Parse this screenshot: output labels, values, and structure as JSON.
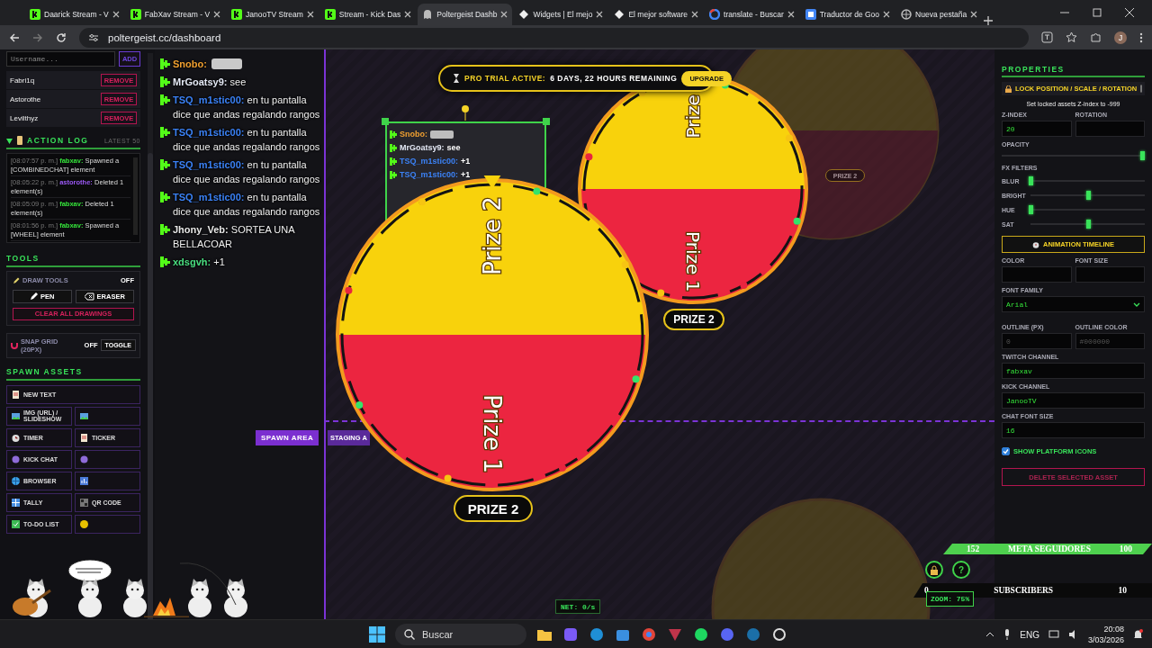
{
  "browser": {
    "tabs": [
      {
        "title": "Daarick Stream - V",
        "selected": false
      },
      {
        "title": "FabXav Stream - V",
        "selected": false
      },
      {
        "title": "JanooTV Stream",
        "selected": false
      },
      {
        "title": "Stream - Kick Das",
        "selected": false
      },
      {
        "title": "Poltergeist Dashb",
        "selected": true
      },
      {
        "title": "Widgets | El mejo",
        "selected": false
      },
      {
        "title": "El mejor software",
        "selected": false
      },
      {
        "title": "translate - Buscar",
        "selected": false
      },
      {
        "title": "Traductor de Goo",
        "selected": false
      },
      {
        "title": "Nueva pestaña",
        "selected": false
      }
    ],
    "url": "poltergeist.cc/dashboard",
    "profile": "J"
  },
  "sidebar": {
    "username": {
      "placeholder": "Username..."
    },
    "add_button": "ADD",
    "users": [
      {
        "name": "Fabri1q",
        "action": "REMOVE"
      },
      {
        "name": "Astorothe",
        "action": "REMOVE"
      },
      {
        "name": "Levilthyz",
        "action": "REMOVE"
      }
    ],
    "action_log": {
      "title": "ACTION LOG",
      "expanded": true,
      "badge": "LATEST 50",
      "entries": [
        {
          "time": "[08:07:57 p. m.]",
          "user": "fabxav:",
          "color": "#35e33a",
          "text": "Spawned a [COMBINEDCHAT] element"
        },
        {
          "time": "[08:05:22 p. m.]",
          "user": "astorothe:",
          "color": "#9b59f5",
          "text": "Deleted 1 element(s)"
        },
        {
          "time": "[08:05:09 p. m.]",
          "user": "fabxav:",
          "color": "#35e33a",
          "text": "Deleted 1 element(s)"
        },
        {
          "time": "[08:01:56 p. m.]",
          "user": "fabxav:",
          "color": "#35e33a",
          "text": "Spawned a [WHEEL] element"
        }
      ]
    },
    "tools": {
      "title": "TOOLS",
      "draw_tools": {
        "label": "DRAW TOOLS",
        "state": "OFF"
      },
      "buttons": [
        {
          "label": "PEN"
        },
        {
          "label": "ERASER"
        }
      ],
      "clear_button": "CLEAR ALL DRAWINGS",
      "snap_grid": {
        "label": "SNAP GRID (20PX)",
        "state": "OFF",
        "toggle": "TOGGLE"
      }
    },
    "spawn_assets": {
      "title": "SPAWN ASSETS",
      "items": [
        {
          "label": "NEW TEXT",
          "kind": "wide"
        },
        {
          "label": "IMG (URL) / SLIDESHOW",
          "kind": "half"
        },
        {
          "kind": "half"
        },
        {
          "label": "TIMER",
          "kind": "half"
        },
        {
          "label": "TICKER",
          "kind": "half"
        },
        {
          "label": "KICK CHAT",
          "kind": "half"
        },
        {
          "kind": "half"
        },
        {
          "label": "BROWSER",
          "kind": "half"
        },
        {
          "kind": "half"
        },
        {
          "label": "TALLY",
          "kind": "half"
        },
        {
          "label": "QR CODE",
          "kind": "half"
        },
        {
          "label": "TO-DO LIST",
          "kind": "half"
        },
        {
          "kind": "half"
        }
      ]
    }
  },
  "canvas": {
    "trial": {
      "label": "PRO TRIAL ACTIVE:",
      "text": "6 DAYS, 22 HOURS REMAINING",
      "button": "UPGRADE"
    },
    "chat_widget": {
      "messages": [
        {
          "user": "Snobo:",
          "color": "#f0a030",
          "emote": true
        },
        {
          "user": "MrGoatsy9:",
          "color": "#e4e9f5",
          "text": "see",
          "emote": false
        },
        {
          "user": "TSQ_m1stic00:",
          "color": "#3b82f6",
          "text": "+1",
          "emote": false
        },
        {
          "user": "TSQ_m1stic00:",
          "color": "#3b82f6",
          "text": "+1",
          "emote": false
        }
      ]
    },
    "wheels": [
      {
        "pointer": true,
        "result": "PRIZE 2",
        "segments": [
          {
            "label": "Prize 2",
            "color": "#f8d20c"
          },
          {
            "label": "Prize 1",
            "color": "#ec2540"
          }
        ]
      },
      {
        "pointer": false,
        "result": "PRIZE 2",
        "segments": [
          {
            "label": "Prize",
            "color": "#f8d20c"
          },
          {
            "label": "Prize 1",
            "color": "#ec2540"
          }
        ]
      }
    ],
    "areas": [
      {
        "label": "SPAWN AREA",
        "kind": "spawn"
      },
      {
        "label": "STAGING A",
        "kind": "staging"
      }
    ],
    "preview": {
      "result": "PRIZE 2"
    },
    "net": "NET: 0/s"
  },
  "chat_overlay": {
    "messages": [
      {
        "user": "Snobo:",
        "color": "#f0a030",
        "emote": true
      },
      {
        "user": "MrGoatsy9:",
        "color": "#e4e9f5",
        "text": "see",
        "emote": false
      },
      {
        "user": "TSQ_m1stic00:",
        "color": "#3b82f6",
        "text": "en tu pantalla dice que andas regalando rangos",
        "emote": false
      },
      {
        "user": "TSQ_m1stic00:",
        "color": "#3b82f6",
        "text": "en tu pantalla dice que andas regalando rangos",
        "emote": false
      },
      {
        "user": "TSQ_m1stic00:",
        "color": "#3b82f6",
        "text": "en tu pantalla dice que andas regalando rangos",
        "emote": false
      },
      {
        "user": "TSQ_m1stic00:",
        "color": "#3b82f6",
        "text": "en tu pantalla dice que andas regalando rangos",
        "emote": false
      },
      {
        "user": "Jhony_Veb:",
        "color": "#e8e8e8",
        "text": "SORTEA UNA BELLACOAR",
        "emote": false
      },
      {
        "user": "xdsgvh:",
        "color": "#4ade80",
        "text": "+1",
        "emote": false
      }
    ]
  },
  "hud": {
    "goals": [
      {
        "current": "152",
        "title": "META SEGUIDORES",
        "target": "100",
        "kind": "followers"
      },
      {
        "current": "0",
        "title": "SUBSCRIBERS",
        "target": "10",
        "kind": "subs"
      }
    ],
    "help": "?",
    "zoom": "ZOOM: 75%"
  },
  "properties": {
    "title": "PROPERTIES",
    "lock": {
      "label": "LOCK POSITION / SCALE / ROTATION",
      "checked": false
    },
    "lock_note": "Set locked assets Z-index to -999",
    "z_index": {
      "label": "Z-INDEX",
      "value": "20"
    },
    "rotation": {
      "label": "ROTATION"
    },
    "opacity": {
      "label": "OPACITY",
      "level": 1
    },
    "fx_title": "FX FILTERS",
    "filters": [
      {
        "label": "BLUR",
        "level": 0
      },
      {
        "label": "BRIGHT",
        "level": 0.5
      },
      {
        "label": "HUE",
        "level": 0
      },
      {
        "label": "SAT",
        "level": 0.5
      }
    ],
    "timeline_button": "ANIMATION TIMELINE",
    "color": {
      "label": "COLOR"
    },
    "font_size": {
      "label": "FONT SIZE"
    },
    "font_family": {
      "label": "FONT FAMILY",
      "value": "Arial"
    },
    "outline": {
      "label": "OUTLINE (PX)",
      "placeholder": "0"
    },
    "outline_color": {
      "label": "OUTLINE COLOR",
      "placeholder": "#000000"
    },
    "twitch": {
      "label": "TWITCH CHANNEL",
      "value": "fabxav"
    },
    "kick": {
      "label": "KICK CHANNEL",
      "value": "JanooTV"
    },
    "chat_font": {
      "label": "CHAT FONT SIZE",
      "value": "16"
    },
    "platform_icons": {
      "label": "SHOW PLATFORM ICONS",
      "checked": true
    },
    "delete_button": "DELETE SELECTED ASSET"
  },
  "taskbar": {
    "search": {
      "placeholder": "Buscar"
    },
    "lang": "ENG",
    "time": "20:08",
    "date": "3/03/2026"
  }
}
